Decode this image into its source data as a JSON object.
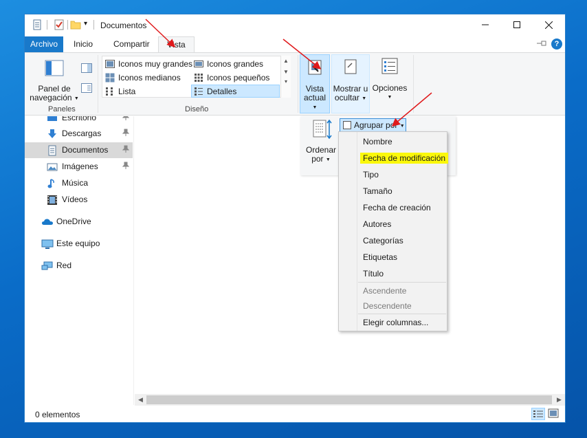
{
  "window": {
    "title": "Documentos"
  },
  "titlebar": {
    "qat_dropdown": "▾"
  },
  "tabs": [
    {
      "label": "Archivo"
    },
    {
      "label": "Inicio"
    },
    {
      "label": "Compartir"
    },
    {
      "label": "Vista"
    }
  ],
  "ribbon": {
    "panes": {
      "nav_pane_line1": "Panel de",
      "nav_pane_line2": "navegación",
      "group_label": "Paneles"
    },
    "layout": {
      "group_label": "Diseño",
      "items": [
        {
          "label": "Iconos muy grandes"
        },
        {
          "label": "Iconos grandes"
        },
        {
          "label": "Iconos medianos"
        },
        {
          "label": "Iconos pequeños"
        },
        {
          "label": "Lista"
        },
        {
          "label": "Detalles"
        }
      ]
    },
    "current_view": {
      "line1": "Vista",
      "line2": "actual"
    },
    "show_hide": {
      "line1": "Mostrar u",
      "line2": "ocultar"
    },
    "options": {
      "label": "Opciones"
    }
  },
  "sort_panel": {
    "sort_by_line1": "Ordenar",
    "sort_by_line2": "por",
    "group_by": "Agrupar por"
  },
  "group_by_menu": {
    "items": [
      {
        "label": "Nombre"
      },
      {
        "label": "Fecha de modificación"
      },
      {
        "label": "Tipo"
      },
      {
        "label": "Tamaño"
      },
      {
        "label": "Fecha de creación"
      },
      {
        "label": "Autores"
      },
      {
        "label": "Categorías"
      },
      {
        "label": "Etiquetas"
      },
      {
        "label": "Título"
      }
    ],
    "order_items": [
      {
        "label": "Ascendente"
      },
      {
        "label": "Descendente"
      }
    ],
    "choose_columns": "Elegir columnas..."
  },
  "nav": {
    "quick_access": [
      {
        "label": "Escritorio"
      },
      {
        "label": "Descargas"
      },
      {
        "label": "Documentos"
      },
      {
        "label": "Imágenes"
      },
      {
        "label": "Música"
      },
      {
        "label": "Vídeos"
      }
    ],
    "roots": [
      {
        "label": "OneDrive"
      },
      {
        "label": "Este equipo"
      },
      {
        "label": "Red"
      }
    ]
  },
  "status": {
    "item_count": "0 elementos"
  },
  "colors": {
    "accent": "#1979ca",
    "selection": "#cce8ff",
    "highlight": "#fbf80b",
    "annotation_arrow": "#e0191b"
  }
}
